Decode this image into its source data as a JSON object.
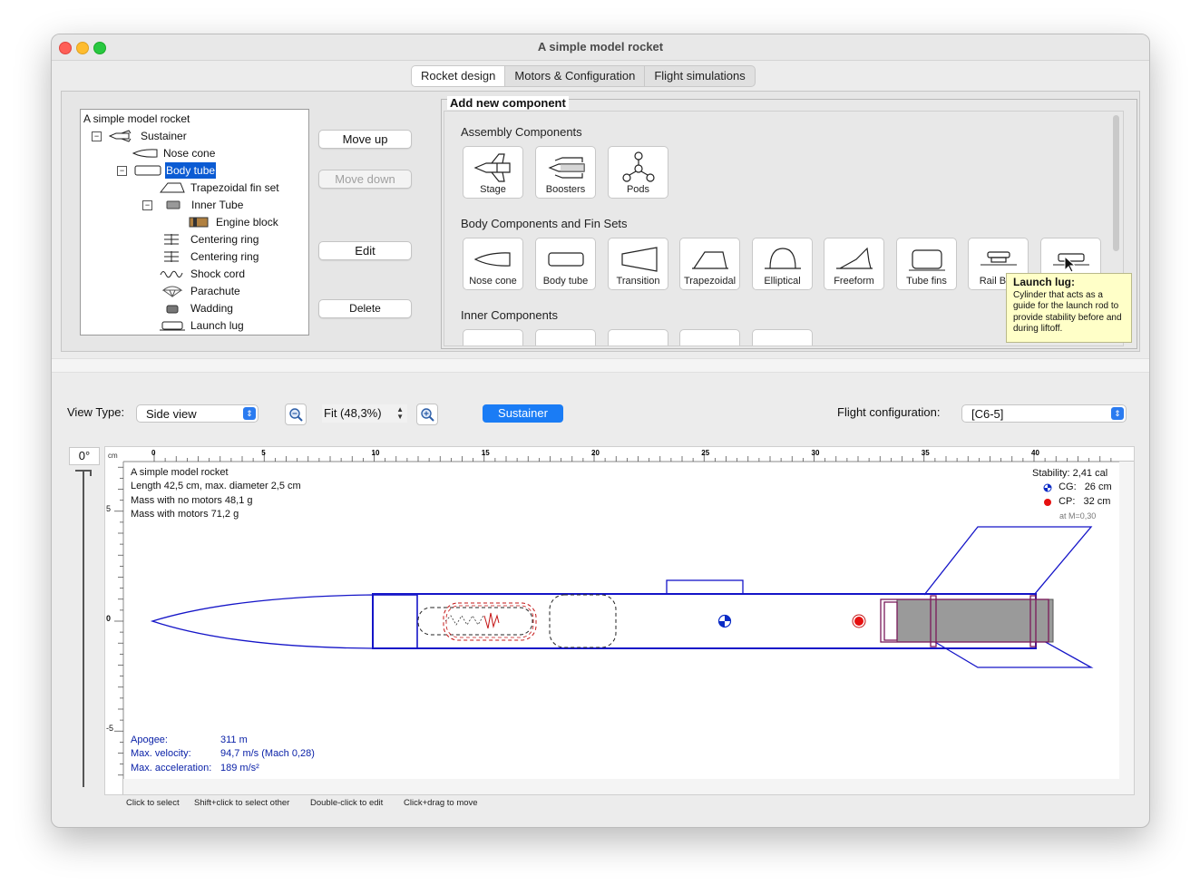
{
  "window": {
    "title": "A simple model rocket"
  },
  "tabs": [
    "Rocket design",
    "Motors & Configuration",
    "Flight simulations"
  ],
  "tree": {
    "root": "A simple model rocket",
    "items": [
      "Sustainer",
      "Nose cone",
      "Body tube",
      "Trapezoidal fin set",
      "Inner Tube",
      "Engine block",
      "Centering ring",
      "Centering ring",
      "Shock cord",
      "Parachute",
      "Wadding",
      "Launch lug"
    ]
  },
  "actions": {
    "move_up": "Move up",
    "move_down": "Move down",
    "edit": "Edit",
    "delete": "Delete"
  },
  "add_panel": {
    "title": "Add new component",
    "assembly_label": "Assembly Components",
    "assembly": [
      "Stage",
      "Boosters",
      "Pods"
    ],
    "body_label": "Body Components and Fin Sets",
    "body": [
      "Nose cone",
      "Body tube",
      "Transition",
      "Trapezoidal",
      "Elliptical",
      "Freeform",
      "Tube fins",
      "Rail Butt",
      ""
    ],
    "inner_label": "Inner Components"
  },
  "tooltip": {
    "title": "Launch lug:",
    "text": "Cylinder that acts as a guide for the launch rod to provide stability before and during liftoff."
  },
  "toolbar": {
    "view_type_label": "View Type:",
    "view_type": "Side view",
    "zoom": "Fit (48,3%)",
    "stage": "Sustainer",
    "flight_config_label": "Flight configuration:",
    "flight_config": "[C6-5]"
  },
  "rotation": "0°",
  "ruler": {
    "unit": "cm",
    "x_ticks": [
      "0",
      "5",
      "10",
      "15",
      "20",
      "25",
      "30",
      "35",
      "40"
    ],
    "y_ticks": [
      "5",
      "0",
      "-5"
    ]
  },
  "figure_info": {
    "name": "A simple model rocket",
    "length": "Length 42,5 cm, max. diameter 2,5 cm",
    "mass_no_motors": "Mass with no motors 48,1 g",
    "mass_with_motors": "Mass with motors 71,2 g"
  },
  "stability": {
    "label": "Stability:",
    "value": "2,41 cal",
    "cg_label": "CG:",
    "cg": "26 cm",
    "cp_label": "CP:",
    "cp": "32 cm",
    "mach": "at M=0,30"
  },
  "flight_stats": {
    "apogee_label": "Apogee:",
    "apogee": "311 m",
    "velocity_label": "Max. velocity:",
    "velocity": "94,7 m/s  (Mach 0,28)",
    "accel_label": "Max. acceleration:",
    "accel": "189 m/s²"
  },
  "hints": [
    "Click to select",
    "Shift+click to select other",
    "Double-click to edit",
    "Click+drag to move"
  ]
}
